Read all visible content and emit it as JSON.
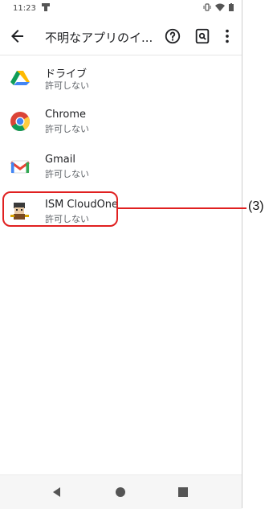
{
  "status_bar": {
    "time": "11:23"
  },
  "app_bar": {
    "title": "不明なアプリのイ..."
  },
  "apps": [
    {
      "name": "ドライブ",
      "status": "許可しない",
      "icon": "google-drive-icon"
    },
    {
      "name": "Chrome",
      "status": "許可しない",
      "icon": "chrome-icon"
    },
    {
      "name": "Gmail",
      "status": "許可しない",
      "icon": "gmail-icon"
    },
    {
      "name": "ISM CloudOne",
      "status": "許可しない",
      "icon": "ism-cloudone-icon"
    }
  ],
  "annotation": {
    "label": "(3)",
    "color": "#e02020"
  },
  "colors": {
    "text_primary": "#202124",
    "text_secondary": "#5f6368",
    "nav_background": "#f6f6f6"
  }
}
